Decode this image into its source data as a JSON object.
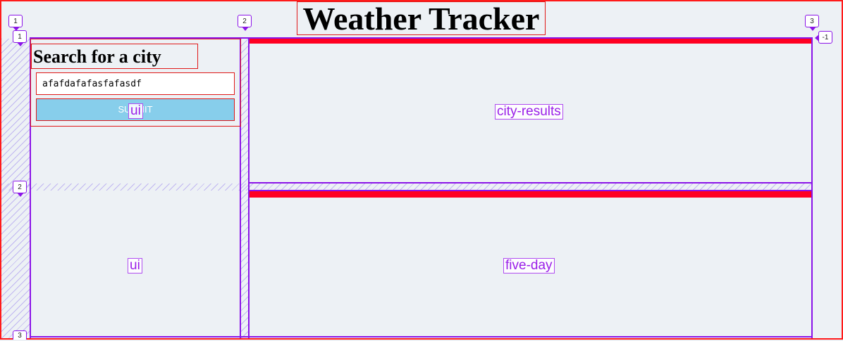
{
  "header": {
    "title": "Weather Tracker"
  },
  "search": {
    "heading": "Search for a city",
    "input_value": "afafdafafasfafasdf",
    "submit_label": "SUBMIT"
  },
  "grid_overlay": {
    "column_lines": [
      "1",
      "2",
      "3",
      "-1"
    ],
    "row_lines": [
      "1",
      "2",
      "3"
    ],
    "areas": {
      "ui_top": "ui",
      "ui_bottom": "ui",
      "city_results": "city-results",
      "five_day": "five-day"
    }
  },
  "colors": {
    "background": "#edf1f5",
    "outline_red": "#ff1a1a",
    "grid_purple": "#8b14e8",
    "submit_button": "#87ceeb",
    "section_bar_red": "#ff0022"
  }
}
